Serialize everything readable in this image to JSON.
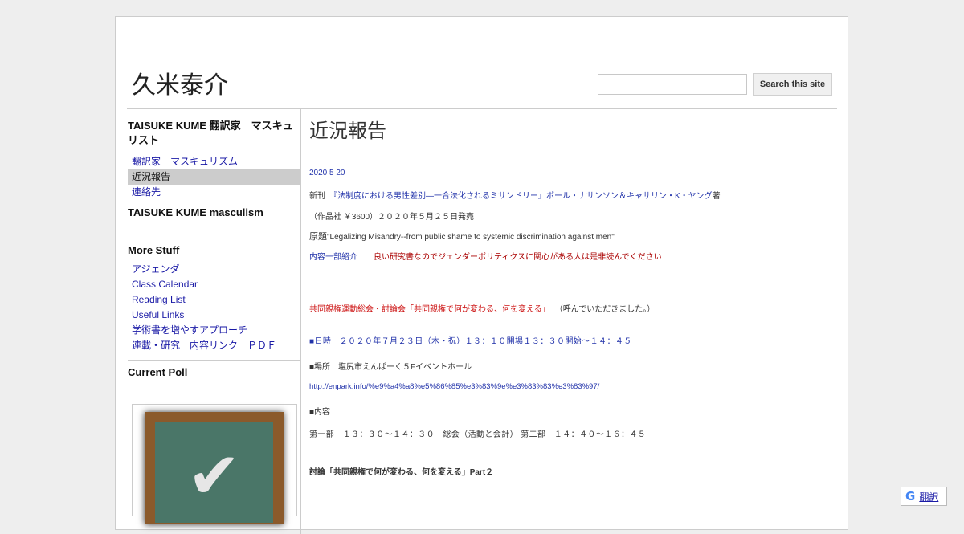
{
  "site": {
    "title": "久米泰介"
  },
  "search": {
    "placeholder": "",
    "button_label": "Search this site"
  },
  "sidebar": {
    "section1_heading": "TAISUKE KUME 翻訳家　マスキュリスト",
    "items": [
      {
        "label": "翻訳家　マスキュリズム"
      },
      {
        "label": "近況報告"
      },
      {
        "label": "連絡先"
      }
    ],
    "section2_heading": "TAISUKE KUME masculism",
    "more_heading": "More Stuff",
    "more_items": [
      {
        "label": "アジェンダ"
      },
      {
        "label": "Class Calendar"
      },
      {
        "label": "Reading List"
      },
      {
        "label": "Useful Links"
      },
      {
        "label": "学術書を増やすアプローチ"
      },
      {
        "label": "連載・研究　内容リンク　ＰＤＦ"
      }
    ],
    "poll_heading": "Current Poll"
  },
  "main": {
    "heading": "近況報告",
    "date": "2020 5 20",
    "line1_prefix": "新刊　",
    "line1_link": "『法制度における男性差別―一合法化されるミサンドリー』ポール・ナサンソン＆キャサリン・K・ヤング",
    "line1_suffix": "著",
    "line2": "（作品社 ￥3600）２０２０年５月２５日発売",
    "line3_prefix": "原題",
    "line3": "\"Legalizing Misandry--from public shame to systemic discrimination against men\"",
    "line4_link": "内容一部紹介",
    "line4_note": "良い研究書なのでジェンダーポリティクスに関心がある人は是非読んでください",
    "event_title": "共同親権運動総会・討論会「共同親権で何が変わる、何を変える」",
    "event_note": "（呼んでいただきました。）",
    "event_date": "■日時　２０２０年７月２３日（木・祝）１３：１０開場１３：３０開始～１４：４５",
    "event_place": "■場所　塩尻市えんぱーく５Fイベントホール",
    "event_url": "http://enpark.info/%e9%a4%a8%e5%86%85%e3%83%9e%e3%83%83%e3%83%97/",
    "event_content_label": "■内容",
    "event_schedule": "第一部　１３：３０～１４：３０　総会（活動と会計） 第二部　１４：４０～１６：４５",
    "discussion": "討論「共同親権で何が変わる、何を変える」Part２"
  },
  "translate": {
    "label": "翻訳"
  }
}
